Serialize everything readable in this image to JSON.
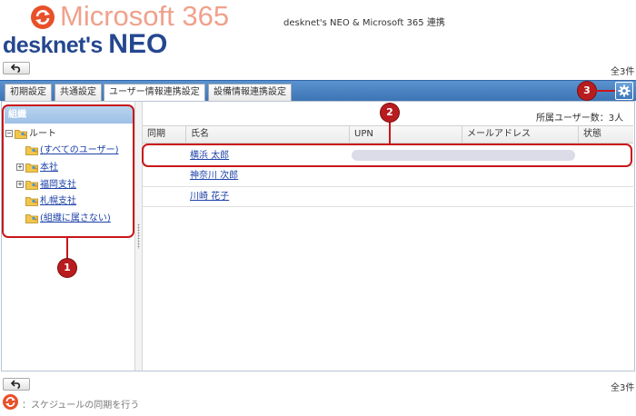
{
  "header": {
    "ms_title": "Microsoft 365",
    "subtitle": "desknet's NEO & Microsoft 365 連携",
    "logo_small": "desknet's ",
    "logo_big": "NEO",
    "accent": "#e8502a",
    "brand": "#24478f"
  },
  "toolbar": {
    "count_top": "全3件",
    "count_bottom": "全3件"
  },
  "tabs": [
    {
      "label": "初期設定",
      "active": false
    },
    {
      "label": "共通設定",
      "active": false
    },
    {
      "label": "ユーザー情報連携設定",
      "active": true
    },
    {
      "label": "設備情報連携設定",
      "active": false
    }
  ],
  "sidebar": {
    "header": "組織",
    "root": "ルート",
    "items": [
      {
        "label": "(すべてのユーザー)",
        "expandable": false
      },
      {
        "label": "本社",
        "expandable": true
      },
      {
        "label": "福岡支社",
        "expandable": true
      },
      {
        "label": "札幌支社",
        "expandable": false
      },
      {
        "label": "(組織に属さない)",
        "expandable": false
      }
    ]
  },
  "main": {
    "member_count": "所属ユーザー数：3人",
    "columns": [
      "同期",
      "氏名",
      "UPN",
      "メールアドレス",
      "状態"
    ],
    "rows": [
      {
        "name": "横浜 太郎"
      },
      {
        "name": "神奈川 次郎"
      },
      {
        "name": "川崎 花子"
      }
    ]
  },
  "callouts": [
    "1",
    "2",
    "3"
  ],
  "footer": {
    "note": "：スケジュールの同期を行う"
  },
  "icons": {
    "sync": "sync-icon",
    "back": "back-arrow-icon",
    "gear": "gear-icon",
    "folder": "org-folder-icon"
  }
}
